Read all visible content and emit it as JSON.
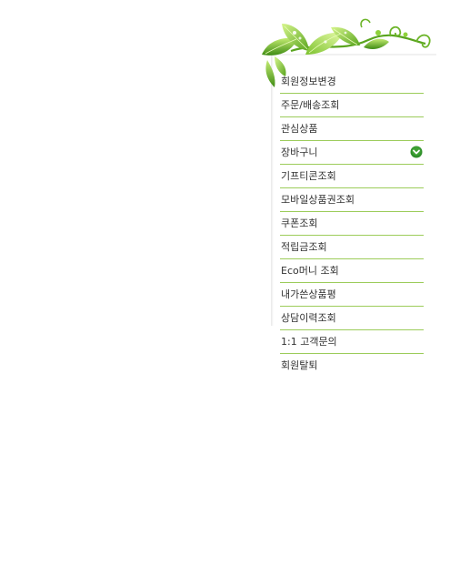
{
  "mypage_menu": {
    "items": [
      {
        "label": "회원정보변경"
      },
      {
        "label": "주문/배송조회"
      },
      {
        "label": "관심상품"
      },
      {
        "label": "장바구니",
        "icon": "chevron-down-circle-icon"
      },
      {
        "label": "기프티콘조회"
      },
      {
        "label": "모바일상품권조회"
      },
      {
        "label": "쿠폰조회"
      },
      {
        "label": "적립금조회"
      },
      {
        "label": "Eco머니 조회"
      },
      {
        "label": "내가쓴상품평"
      },
      {
        "label": "상담이력조회"
      },
      {
        "label": "1:1 고객문의"
      },
      {
        "label": "회원탈퇴"
      }
    ]
  },
  "colors": {
    "divider": "#9ccc5a",
    "leaf_light": "#b4e063",
    "leaf_dark": "#4f9a1c",
    "chevron_bg": "#2f8f2a",
    "text": "#333333"
  }
}
